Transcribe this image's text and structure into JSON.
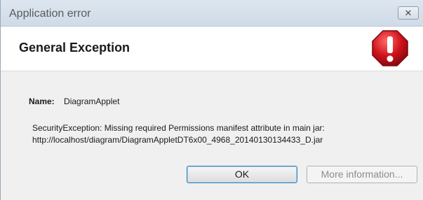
{
  "window": {
    "title": "Application error",
    "close_glyph": "✕"
  },
  "header": {
    "title": "General Exception",
    "icon": "error-stop-icon"
  },
  "details": {
    "name_label": "Name:",
    "name_value": "DiagramApplet",
    "message_line1": "SecurityException: Missing required Permissions manifest attribute in main jar:",
    "message_line2": "http://localhost/diagram/DiagramAppletDT6x00_4968_20140130134433_D.jar"
  },
  "buttons": {
    "ok_label": "OK",
    "more_info_label": "More information..."
  },
  "colors": {
    "icon_red": "#d0121b",
    "titlebar": "#d6e0ea"
  }
}
